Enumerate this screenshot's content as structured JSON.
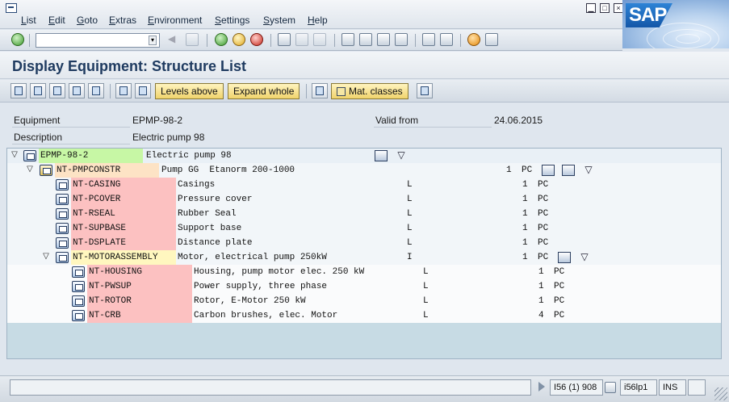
{
  "menu": {
    "items": [
      "List",
      "Edit",
      "Goto",
      "Extras",
      "Environment",
      "Settings",
      "System",
      "Help"
    ]
  },
  "window": {
    "minimize": "▁",
    "maximize": "□",
    "close": "×"
  },
  "logo": {
    "text": "SAP"
  },
  "toolbar": {
    "command_value": "",
    "command_dropdown": "▾"
  },
  "page": {
    "title": "Display Equipment: Structure List"
  },
  "app_toolbar": {
    "levels_above": "Levels above",
    "expand_whole": "Expand whole",
    "mat_classes": "Mat. classes"
  },
  "header": {
    "equipment_label": "Equipment",
    "equipment_value": "EPMP-98-2",
    "description_label": "Description",
    "description_value": "Electric pump 98",
    "valid_from_label": "Valid from",
    "valid_from_value": "24.06.2015"
  },
  "tree": {
    "root": {
      "key": "EPMP-98-2",
      "text": "Electric pump 98"
    },
    "rows": [
      {
        "key": "NT-PMPCONSTR",
        "text": "Pump GG  Etanorm 200-1000",
        "cat": "",
        "qty": "1",
        "unit": "PC"
      },
      {
        "key": "NT-CASING",
        "text": "Casings",
        "cat": "L",
        "qty": "1",
        "unit": "PC"
      },
      {
        "key": "NT-PCOVER",
        "text": "Pressure cover",
        "cat": "L",
        "qty": "1",
        "unit": "PC"
      },
      {
        "key": "NT-RSEAL",
        "text": "Rubber Seal",
        "cat": "L",
        "qty": "1",
        "unit": "PC"
      },
      {
        "key": "NT-SUPBASE",
        "text": "Support base",
        "cat": "L",
        "qty": "1",
        "unit": "PC"
      },
      {
        "key": "NT-DSPLATE",
        "text": "Distance plate",
        "cat": "L",
        "qty": "1",
        "unit": "PC"
      },
      {
        "key": "NT-MOTORASSEMBLY",
        "text": "Motor, electrical pump 250kW",
        "cat": "I",
        "qty": "1",
        "unit": "PC"
      },
      {
        "key": "NT-HOUSING",
        "text": "Housing, pump motor elec. 250 kW",
        "cat": "L",
        "qty": "1",
        "unit": "PC"
      },
      {
        "key": "NT-PWSUP",
        "text": "Power supply, three phase",
        "cat": "L",
        "qty": "1",
        "unit": "PC"
      },
      {
        "key": "NT-ROTOR",
        "text": "Rotor, E-Motor 250 kW",
        "cat": "L",
        "qty": "1",
        "unit": "PC"
      },
      {
        "key": "NT-CRB",
        "text": "Carbon brushes, elec. Motor",
        "cat": "L",
        "qty": "4",
        "unit": "PC"
      }
    ],
    "expanded_glyph": "▽"
  },
  "status": {
    "session": "I56 (1) 908",
    "server": "i56lp1",
    "mode": "INS"
  },
  "colors": {
    "title": "#1f3b60",
    "tree_bg": "#c7dbe4",
    "key_green": "#c7f7a5",
    "key_orange": "#fde3c5",
    "key_red": "#fcc1c1",
    "key_yellow": "#fff7bf"
  }
}
